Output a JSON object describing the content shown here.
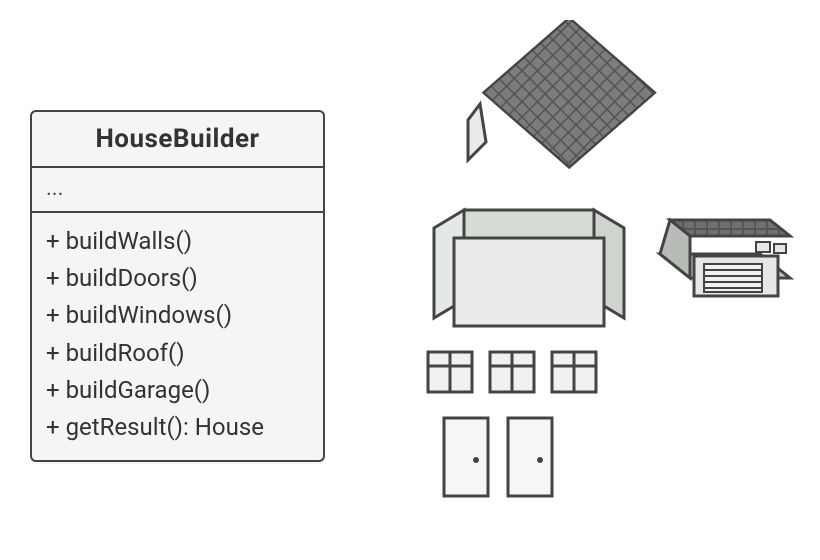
{
  "class_box": {
    "name": "HouseBuilder",
    "fields_placeholder": "...",
    "methods": [
      "+ buildWalls()",
      "+ buildDoors()",
      "+ buildWindows()",
      "+ buildRoof()",
      "+ buildGarage()",
      "+ getResult(): House"
    ]
  },
  "illustration": {
    "parts": [
      "roof",
      "walls",
      "windows",
      "doors",
      "garage"
    ],
    "counts": {
      "windows": 3,
      "doors": 2
    }
  }
}
